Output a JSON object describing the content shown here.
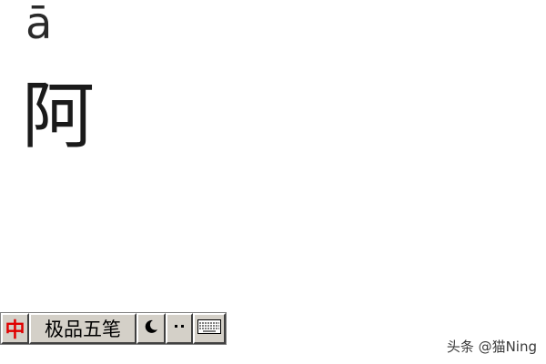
{
  "content": {
    "pinyin": "ā",
    "hanzi": "阿"
  },
  "ime_toolbar": {
    "lang_indicator": "中",
    "input_method_name": "极品五笔",
    "icons": {
      "mode": "moon-icon",
      "punctuation": "punctuation-icon",
      "keyboard": "keyboard-icon"
    },
    "colors": {
      "lang_indicator": "#e00000",
      "bar_background": "#d4d0c8"
    }
  },
  "watermark": {
    "text": "头条 @猫Ning"
  }
}
